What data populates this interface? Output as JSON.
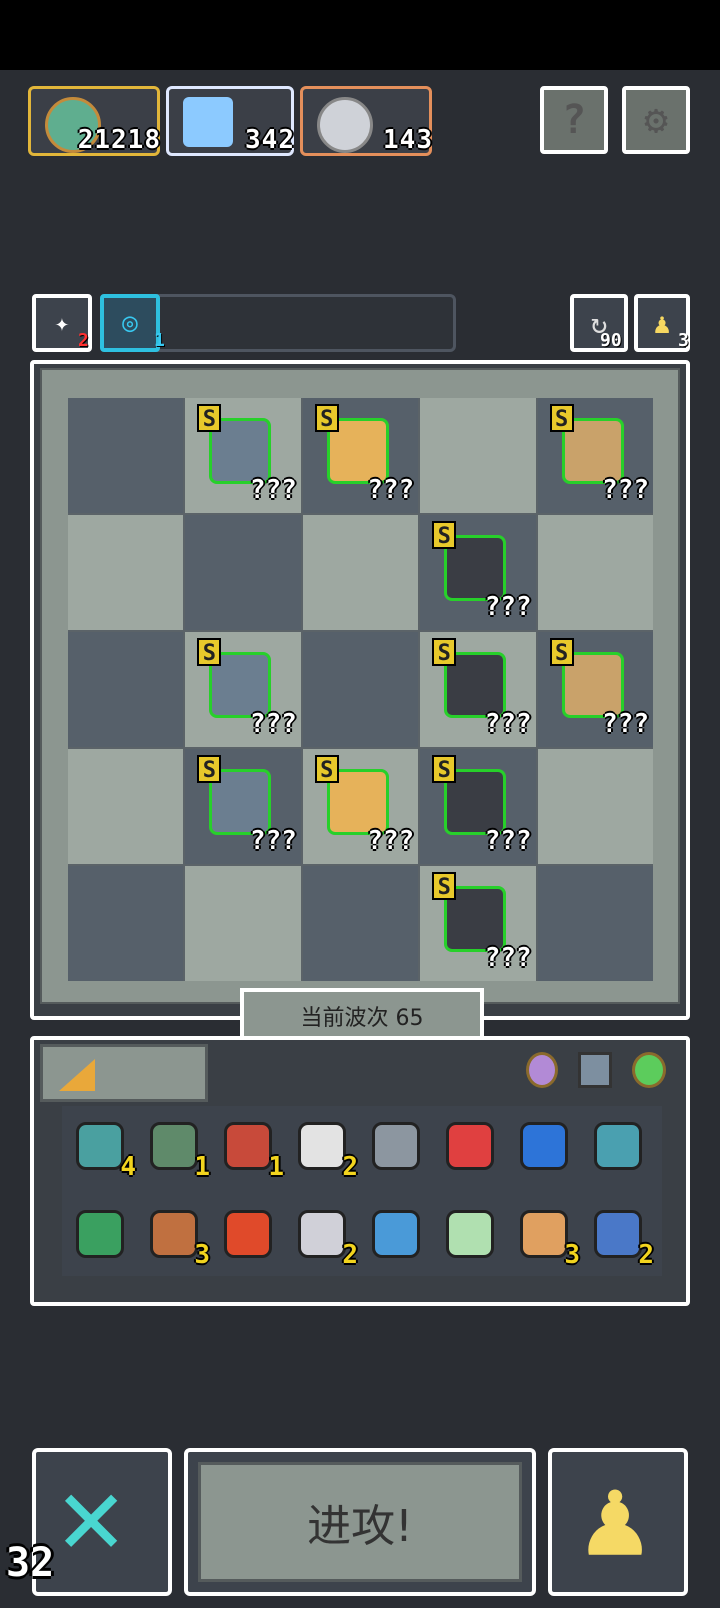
{
  "resources": [
    {
      "name": "gold-coin-icon",
      "value": "21218",
      "border": "#e2b63a"
    },
    {
      "name": "blue-crystal-butterfly-icon",
      "value": "342",
      "border": "#9bc6ff"
    },
    {
      "name": "gear-disc-icon",
      "value": "143",
      "border": "#e48f5b"
    }
  ],
  "top_buttons": {
    "help_icon": "question-icon",
    "settings_icon": "gear-icon"
  },
  "status": {
    "left_count": "2",
    "blue_count": "1",
    "refresh_count": "90",
    "pawn_count": "3"
  },
  "board": {
    "rows": [
      [
        "",
        "S",
        "S",
        "",
        "S"
      ],
      [
        "",
        "",
        "",
        "S",
        ""
      ],
      [
        "",
        "S",
        "",
        "S",
        "S"
      ],
      [
        "",
        "S",
        "S",
        "S",
        ""
      ],
      [
        "",
        "",
        "",
        "S",
        ""
      ]
    ],
    "unknown_label": "???",
    "wave_label": "当前波次 65"
  },
  "inventory": {
    "row1": [
      {
        "icon": "heart-icon",
        "count": "4"
      },
      {
        "icon": "zombie-icon",
        "count": "1"
      },
      {
        "icon": "eye-orb-icon",
        "count": "1"
      },
      {
        "icon": "chip-icon",
        "count": "2"
      },
      {
        "icon": "stone-icon",
        "count": ""
      },
      {
        "icon": "battery-icon",
        "count": ""
      },
      {
        "icon": "blue-orb-icon",
        "count": ""
      },
      {
        "icon": "shield-orb-icon",
        "count": ""
      }
    ],
    "row2": [
      {
        "icon": "trash-icon",
        "count": ""
      },
      {
        "icon": "book-icon",
        "count": "3"
      },
      {
        "icon": "ruby-icon",
        "count": ""
      },
      {
        "icon": "disc-icon",
        "count": "2"
      },
      {
        "icon": "network-icon",
        "count": ""
      },
      {
        "icon": "potion-icon",
        "count": ""
      },
      {
        "icon": "toilet-icon",
        "count": "3"
      },
      {
        "icon": "flag-icon",
        "count": "2"
      }
    ]
  },
  "bottom": {
    "attack_label": "进攻!",
    "corner_number": "32"
  }
}
